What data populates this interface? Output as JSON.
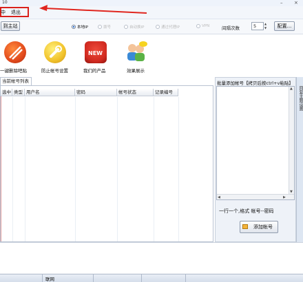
{
  "window": {
    "title": "10",
    "minimize": "–",
    "close": "×"
  },
  "menu": {
    "item1": "中",
    "item2": "退出"
  },
  "toolbar": {
    "back_button": "到主站",
    "radios": [
      "本地IP",
      "拨号",
      "自动换IP",
      "通过代理IP",
      "VPN"
    ],
    "retry_label": "间隔次数",
    "retry_value": "5",
    "config_button": "配置..."
  },
  "icons": [
    {
      "name": "sword-icon",
      "label": "一键删除吧贴",
      "color": "#e24a1c"
    },
    {
      "name": "wrench-icon",
      "label": "防止帐号设置",
      "color": "#f1c22a"
    },
    {
      "name": "new-badge-icon",
      "label": "我们的产品",
      "color": "#d12a20"
    },
    {
      "name": "people-icon",
      "label": "效果展示",
      "color": "#5bb246"
    }
  ],
  "list": {
    "tab_label": "当前帐号列表",
    "columns": [
      "选中",
      "类型",
      "用户名",
      "密码",
      "帐号状态",
      "记录编号"
    ]
  },
  "side": {
    "title": "批量添加帐号【拷贝后按ctrl+v粘贴】",
    "hint": "一行一个,格式 帐号--密码",
    "add_button": "添加帐号",
    "vtab_text": "回复主题设置"
  },
  "status": {
    "text": "联网"
  },
  "colors": {
    "highlight_box": "#d9201b",
    "arrow": "#e0251e"
  }
}
